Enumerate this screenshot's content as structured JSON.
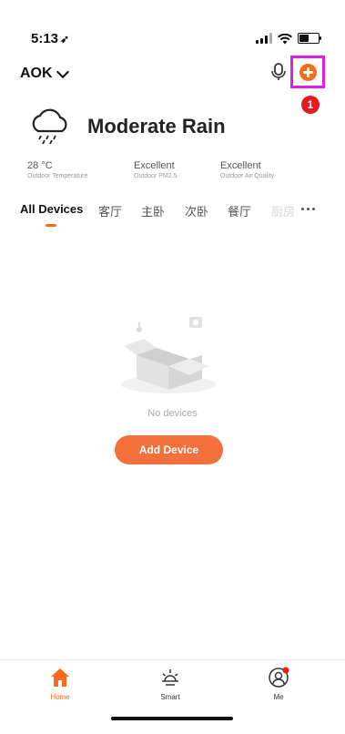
{
  "status_bar": {
    "time": "5:13",
    "location_glyph": "➶"
  },
  "header": {
    "home_name": "AOK",
    "step_badge": "1"
  },
  "weather": {
    "condition": "Moderate Rain",
    "metrics": [
      {
        "value": "28 °C",
        "label": "Outdoor Temperature"
      },
      {
        "value": "Excellent",
        "label": "Outdoor PM2.5"
      },
      {
        "value": "Excellent",
        "label": "Outdoor Air Quality"
      }
    ]
  },
  "tabs": [
    {
      "label": "All Devices",
      "active": true
    },
    {
      "label": "客厅"
    },
    {
      "label": "主卧"
    },
    {
      "label": "次卧"
    },
    {
      "label": "餐厅"
    },
    {
      "label": "厨房",
      "faded": true
    }
  ],
  "empty_state": {
    "message": "No devices",
    "button_label": "Add Device"
  },
  "bottom_nav": [
    {
      "label": "Home",
      "icon": "home-icon",
      "active": true
    },
    {
      "label": "Smart",
      "icon": "sun-icon"
    },
    {
      "label": "Me",
      "icon": "profile-icon",
      "notification_dot": true
    }
  ],
  "colors": {
    "accent": "#ff6a1a",
    "highlight_box": "#e01fe0",
    "badge": "#e51b24"
  }
}
